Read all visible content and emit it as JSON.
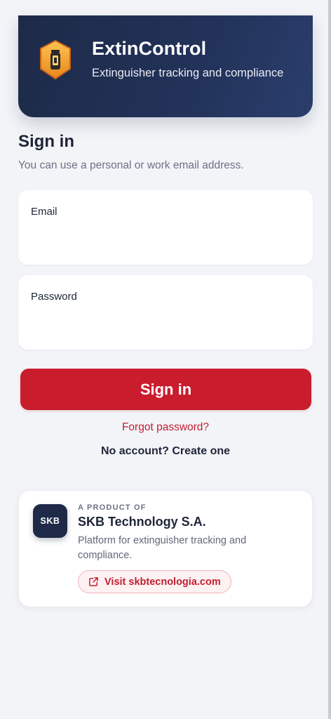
{
  "header": {
    "app_name": "ExtinControl",
    "tagline": "Extinguisher tracking and compliance",
    "logo_icon": "extinguisher-shield-icon"
  },
  "signin": {
    "title": "Sign in",
    "subtitle": "You can use a personal or work email address.",
    "email_label": "Email",
    "email_value": "",
    "password_label": "Password",
    "password_value": "",
    "submit_label": "Sign in",
    "forgot_label": "Forgot password?",
    "create_account_label": "No account? Create one"
  },
  "product": {
    "badge": "SKB",
    "kicker": "A PRODUCT OF",
    "company": "SKB Technology S.A.",
    "description": "Platform for extinguisher tracking and compliance.",
    "visit_label": "Visit skbtecnologia.com",
    "visit_icon": "external-link-icon"
  },
  "colors": {
    "brand_navy": "#1e2a47",
    "accent_red": "#c91d2e",
    "background": "#f3f4f8",
    "logo_orange": "#f2a021"
  }
}
